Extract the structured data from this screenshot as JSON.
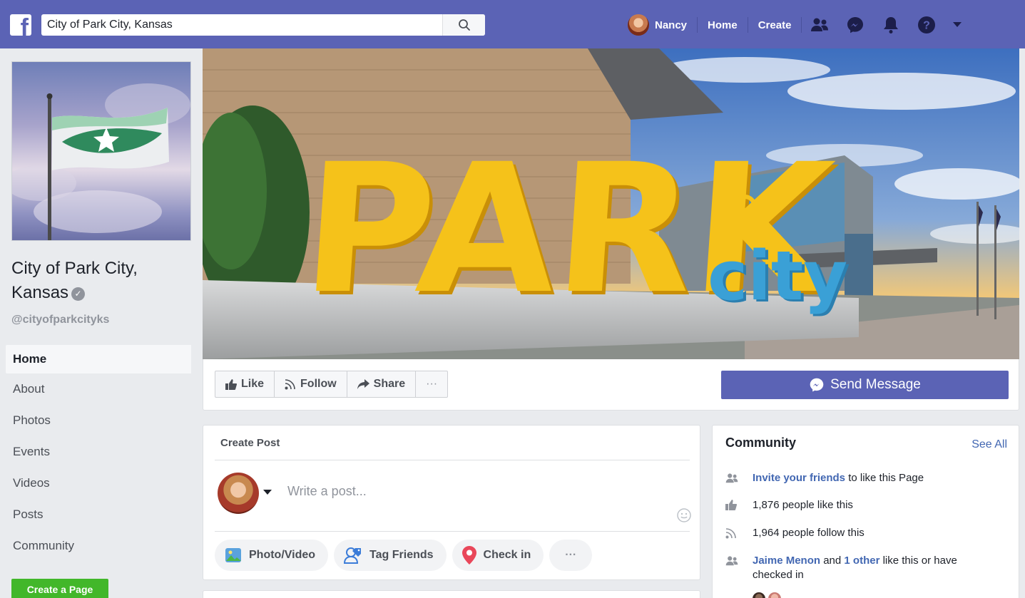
{
  "topbar": {
    "search_value": "City of Park City, Kansas",
    "user_name": "Nancy",
    "home_label": "Home",
    "create_label": "Create"
  },
  "page": {
    "name": "City of Park City, Kansas",
    "handle": "@cityofparkcityks",
    "cover_text_park": "PARK",
    "cover_text_city": "city"
  },
  "sidebar": {
    "items": [
      {
        "label": "Home"
      },
      {
        "label": "About"
      },
      {
        "label": "Photos"
      },
      {
        "label": "Events"
      },
      {
        "label": "Videos"
      },
      {
        "label": "Posts"
      },
      {
        "label": "Community"
      }
    ],
    "create_page_label": "Create a Page"
  },
  "actions": {
    "like": "Like",
    "follow": "Follow",
    "share": "Share",
    "more": "···",
    "send_message": "Send Message"
  },
  "create_post": {
    "title": "Create Post",
    "placeholder": "Write a post...",
    "photo_video": "Photo/Video",
    "tag_friends": "Tag Friends",
    "check_in": "Check in",
    "more": "···"
  },
  "community": {
    "title": "Community",
    "see_all": "See All",
    "invite_link": "Invite your friends",
    "invite_rest": " to like this Page",
    "likes": "1,876 people like this",
    "follows": "1,964 people follow this",
    "friend_name": "Jaime Menon",
    "friend_and": " and ",
    "friend_other": "1 other",
    "friend_rest": " like this or have checked in"
  },
  "colors": {
    "brand": "#5b63b5",
    "link": "#4267b2",
    "green": "#42b72a",
    "cover_yellow": "#f5c21a",
    "cover_blue": "#3aa0d6"
  }
}
